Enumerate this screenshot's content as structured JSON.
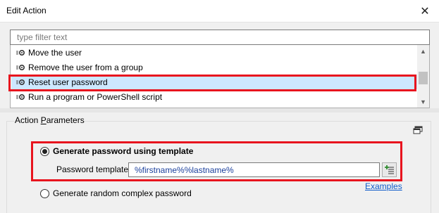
{
  "window": {
    "title": "Edit Action",
    "close_glyph": "✕"
  },
  "filter": {
    "placeholder": "type filter text",
    "value": ""
  },
  "actions_list": {
    "items": [
      {
        "label": "Move the user",
        "icon": "gear-icon",
        "selected": false
      },
      {
        "label": "Remove the user from a group",
        "icon": "gear-icon",
        "selected": false
      },
      {
        "label": "Reset user password",
        "icon": "gear-icon",
        "selected": true
      },
      {
        "label": "Run a program or PowerShell script",
        "icon": "gear-icon",
        "selected": false
      }
    ],
    "scroll_up_glyph": "▲",
    "scroll_down_glyph": "▼"
  },
  "parameters": {
    "legend_prefix": "Action ",
    "legend_underlined": "P",
    "legend_suffix": "arameters",
    "options": [
      {
        "label": "Generate password using template",
        "checked": true
      },
      {
        "label": "Generate random complex password",
        "checked": false
      }
    ],
    "template_label": "Password template:",
    "template_value": "%firstname%%lastname%",
    "examples_link": "Examples"
  },
  "colors": {
    "highlight_red": "#e8141e",
    "selected_row": "#cde8ff",
    "link_blue": "#0f5bc9",
    "template_text": "#1a3f9c"
  }
}
